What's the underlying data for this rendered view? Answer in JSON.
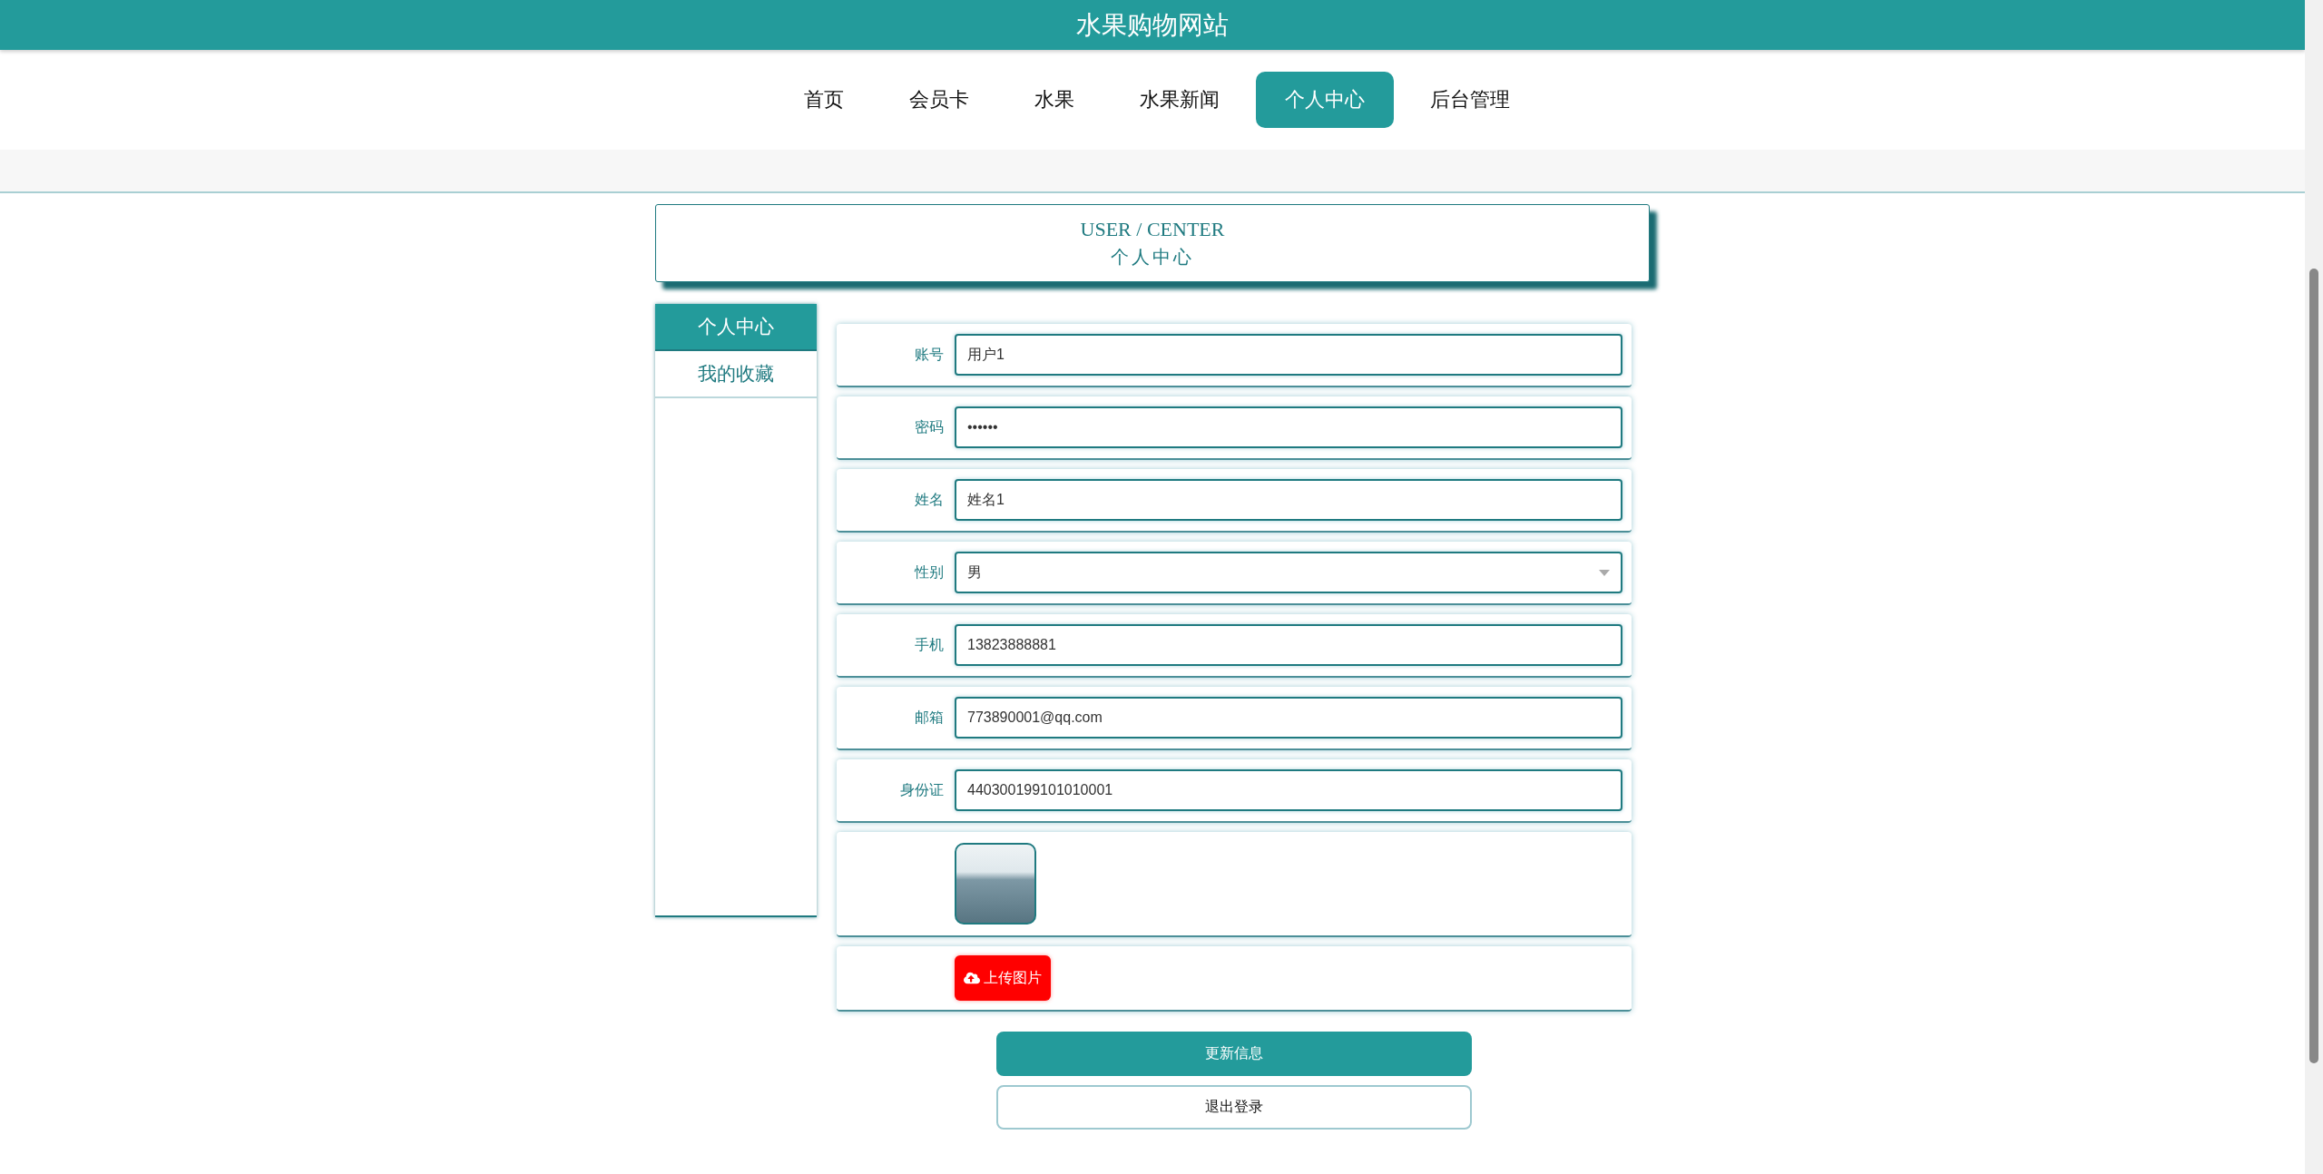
{
  "site_title": "水果购物网站",
  "nav": [
    {
      "label": "首页",
      "selected": false
    },
    {
      "label": "会员卡",
      "selected": false
    },
    {
      "label": "水果",
      "selected": false
    },
    {
      "label": "水果新闻",
      "selected": false
    },
    {
      "label": "个人中心",
      "selected": true
    },
    {
      "label": "后台管理",
      "selected": false
    }
  ],
  "page_heading": {
    "english": "USER / CENTER",
    "chinese": "个人中心"
  },
  "sidebar": {
    "items": [
      {
        "label": "个人中心",
        "selected": true
      },
      {
        "label": "我的收藏",
        "selected": false
      }
    ]
  },
  "form": {
    "fields": [
      {
        "label": "账号",
        "kind": "text",
        "value": "用户1"
      },
      {
        "label": "密码",
        "kind": "text",
        "value": "••••••"
      },
      {
        "label": "姓名",
        "kind": "text",
        "value": "姓名1"
      },
      {
        "label": "性别",
        "kind": "select",
        "value": "男"
      },
      {
        "label": "手机",
        "kind": "text",
        "value": "13823888881"
      },
      {
        "label": "邮箱",
        "kind": "text",
        "value": "773890001@qq.com"
      },
      {
        "label": "身份证",
        "kind": "text",
        "value": "440300199101010001"
      }
    ],
    "upload_button": "上传图片"
  },
  "buttons": {
    "update": "更新信息",
    "logout": "退出登录"
  }
}
